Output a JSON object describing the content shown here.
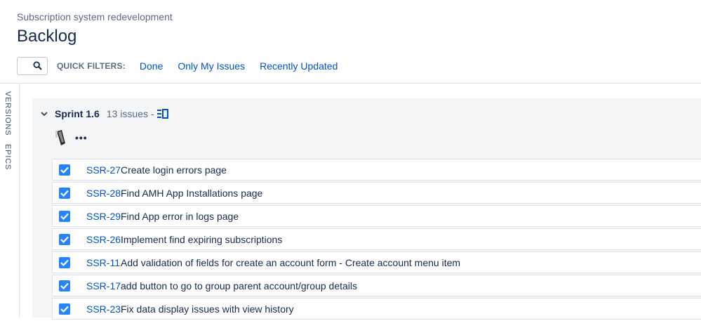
{
  "header": {
    "breadcrumb": "Subscription system redevelopment",
    "title": "Backlog"
  },
  "toolbar": {
    "search_icon": "search-icon",
    "quick_filters_label": "QUICK FILTERS:",
    "filters": [
      "Done",
      "Only My Issues",
      "Recently Updated"
    ]
  },
  "side_rail": {
    "tabs": [
      "VERSIONS",
      "EPICS"
    ]
  },
  "sprint": {
    "name": "Sprint 1.6",
    "issue_count": "13 issues",
    "separator": "-",
    "board_icon": "board-icon",
    "more_label": "•••",
    "issues": [
      {
        "key": "SSR-27",
        "summary": "Create login errors page",
        "checked": true
      },
      {
        "key": "SSR-28",
        "summary": "Find AMH App Installations page",
        "checked": true
      },
      {
        "key": "SSR-29",
        "summary": "Find App error in logs page",
        "checked": true
      },
      {
        "key": "SSR-26",
        "summary": "Implement find expiring subscriptions",
        "checked": true
      },
      {
        "key": "SSR-11",
        "summary": "Add validation of fields for create an account form - Create account menu item",
        "checked": true
      },
      {
        "key": "SSR-17",
        "summary": "add button to go to group parent account/group details",
        "checked": true
      },
      {
        "key": "SSR-23",
        "summary": "Fix data display issues with view history",
        "checked": true
      }
    ]
  },
  "colors": {
    "link": "#0052cc",
    "checkbox": "#2684ff",
    "panel": "#f4f5f7"
  }
}
